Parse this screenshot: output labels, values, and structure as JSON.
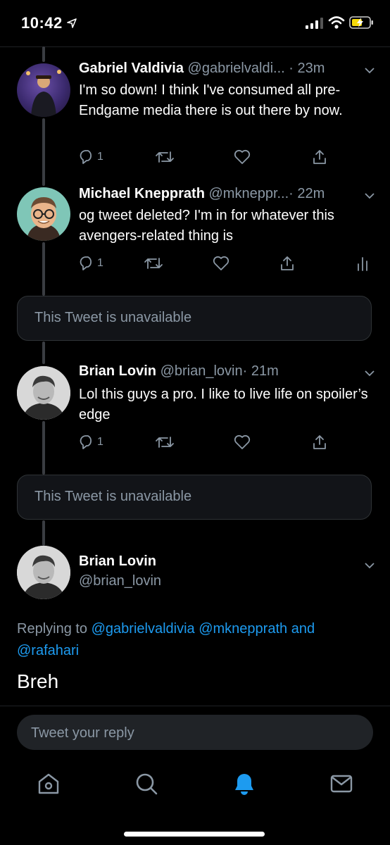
{
  "status_bar": {
    "time": "10:42"
  },
  "tweets": [
    {
      "name": "Gabriel Valdivia",
      "handle": "@gabrielvaldi...",
      "time": "· 23m",
      "text": "I'm so down! I think I've consumed all pre-Endgame media there is out there by now.",
      "reply_count": "1"
    },
    {
      "name": "Michael Knepprath",
      "handle": "@mkneppr...",
      "time": "· 22m",
      "text": "og tweet deleted? I'm in for whatever this avengers-related thing is",
      "reply_count": "1"
    },
    {
      "name": "Brian Lovin",
      "handle": "@brian_lovin",
      "time": "· 21m",
      "text": "Lol this guys a pro. I like to live life on spoiler’s edge",
      "reply_count": "1"
    }
  ],
  "unavailable_label": "This Tweet is unavailable",
  "main_tweet": {
    "name": "Brian Lovin",
    "handle": "@brian_lovin",
    "replying_prefix": "Replying to",
    "replying_users": "@gabrielvaldivia @mknepprath and @rafahari",
    "text": "Breh"
  },
  "reply_input": {
    "placeholder": "Tweet your reply"
  },
  "tab_bar": [
    "home-icon",
    "search-icon",
    "notifications-icon",
    "messages-icon"
  ],
  "colors": {
    "accent": "#1d9bf0",
    "muted": "#8b98a5",
    "background": "#000000"
  }
}
